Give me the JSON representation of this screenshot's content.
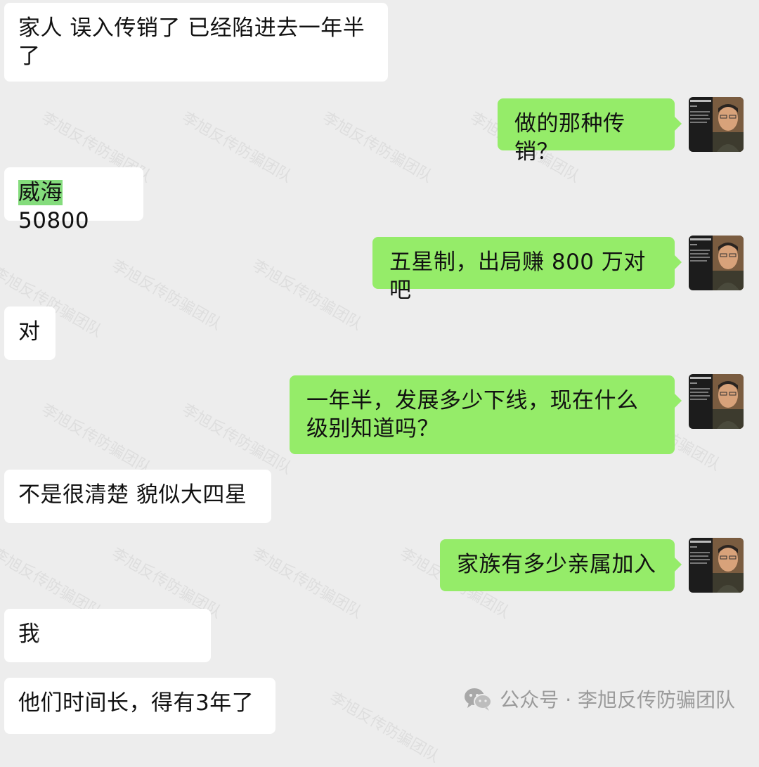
{
  "conversation": {
    "messages": [
      {
        "side": "incoming",
        "text": "家人 误入传销了  已经陷进去一年半了"
      },
      {
        "side": "outgoing",
        "text": "做的那种传销？"
      },
      {
        "side": "incoming",
        "highlight": "威海",
        "text_rest": "50800"
      },
      {
        "side": "outgoing",
        "text": "五星制，出局赚 800 万对吧"
      },
      {
        "side": "incoming",
        "text": "对"
      },
      {
        "side": "outgoing",
        "text": "一年半，发展多少下线，现在什么级别知道吗？"
      },
      {
        "side": "incoming",
        "text": "不是很清楚  貌似大四星"
      },
      {
        "side": "outgoing",
        "text": "家族有多少亲属加入"
      },
      {
        "side": "incoming",
        "text": "我"
      },
      {
        "side": "incoming",
        "text": "他们时间长，得有3年了"
      }
    ]
  },
  "watermark": {
    "text": "李旭反传防骗团队"
  },
  "footer": {
    "label": "公众号 · 李旭反传防骗团队",
    "icon": "wechat-official-account-icon"
  },
  "colors": {
    "background": "#ededed",
    "incoming_bubble": "#ffffff",
    "outgoing_bubble": "#95ec69",
    "highlight": "#84dc7c"
  }
}
